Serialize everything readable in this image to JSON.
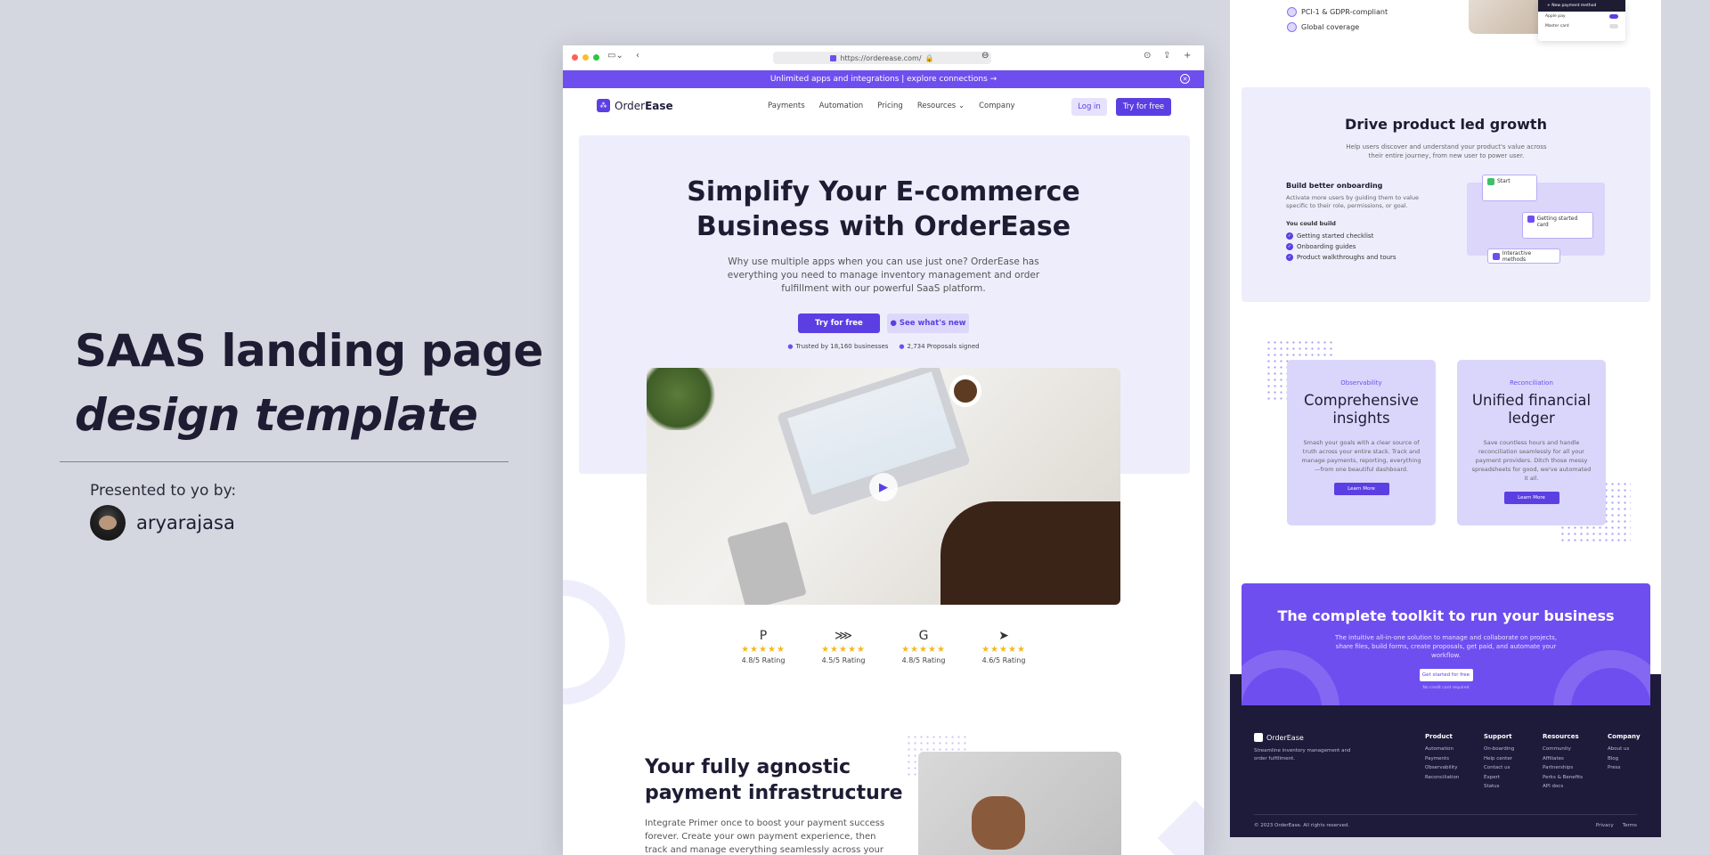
{
  "left": {
    "title_line1": "SAAS landing page",
    "title_line2": "design template",
    "presented": "Presented to yo by:",
    "author": "aryarajasa"
  },
  "browser": {
    "url": "https://orderease.com/",
    "banner": "Unlimited apps and integrations | explore connections →",
    "brand_prefix": "Order",
    "brand_suffix": "Ease",
    "nav": [
      "Payments",
      "Automation",
      "Pricing",
      "Resources ⌄",
      "Company"
    ],
    "login": "Log in",
    "try": "Try for free",
    "hero_title_1": "Simplify Your E-commerce",
    "hero_title_2": "Business with OrderEase",
    "hero_sub": "Why use multiple apps when you can use just one? OrderEase has everything you need to manage inventory management and order fulfillment with our powerful SaaS platform.",
    "cta_primary": "Try for free",
    "cta_secondary": "See what's new",
    "trust": [
      "Trusted by 18,160 businesses",
      "2,734 Proposals signed"
    ],
    "ratings": [
      {
        "icon": "P",
        "stars": "★★★★★",
        "label": "4.8/5 Rating"
      },
      {
        "icon": "⋙",
        "stars": "★★★★★",
        "label": "4.5/5 Rating"
      },
      {
        "icon": "G",
        "stars": "★★★★★",
        "label": "4.8/5 Rating"
      },
      {
        "icon": "➤",
        "stars": "★★★★★",
        "label": "4.6/5 Rating"
      }
    ],
    "section2_title_1": "Your fully agnostic",
    "section2_title_2": "payment infrastructure",
    "section2_text": "Integrate Primer once to boost your payment success forever. Create your own payment experience, then track and manage everything seamlessly across your"
  },
  "right": {
    "features": [
      "PCI-1 & GDPR-compliant",
      "Global coverage"
    ],
    "paycard": {
      "header": "+ New payment method",
      "rows": [
        "Apple pay",
        "Master card"
      ]
    },
    "drive_title": "Drive product led growth",
    "drive_sub": "Help users discover and understand your product's value across their entire journey, from new user to power user.",
    "onboarding_title": "Build better onboarding",
    "onboarding_text": "Activate more users by guiding them to value specific to their role, permissions, or goal.",
    "you_could": "You could build",
    "checklist": [
      "Getting started checklist",
      "Onboarding guides",
      "Product walkthroughs and tours"
    ],
    "flow": {
      "start": "Start",
      "card": "Getting started card",
      "methods": "Interactive methods"
    },
    "cards": [
      {
        "tag": "Observability",
        "title": "Comprehensive insights",
        "text": "Smash your goals with a clear source of truth across your entire stack. Track and manage payments, reporting, everything—from one beautiful dashboard.",
        "button": "Learn More"
      },
      {
        "tag": "Reconciliation",
        "title": "Unified financial ledger",
        "text": "Save countless hours and handle reconciliation seamlessly for all your payment providers. Ditch those messy spreadsheets for good, we've automated it all.",
        "button": "Learn More"
      }
    ],
    "toolkit_title": "The complete toolkit to run your business",
    "toolkit_text": "The intuitive all-in-one solution to manage and collaborate on projects, share files, build forms, create proposals, get paid, and automate your workflow.",
    "toolkit_button": "Get started for free",
    "toolkit_note": "No credit card required",
    "footer": {
      "brand": "OrderEase",
      "tagline": "Streamline inventory management and order fulfillment.",
      "columns": [
        {
          "title": "Product",
          "items": [
            "Automation",
            "Payments",
            "Observability",
            "Reconciliation"
          ]
        },
        {
          "title": "Support",
          "items": [
            "On-boarding",
            "Help center",
            "Contact us",
            "Expert",
            "Status"
          ]
        },
        {
          "title": "Resources",
          "items": [
            "Community",
            "Affiliates",
            "Partnerships",
            "Perks & Benefits",
            "API docs"
          ]
        },
        {
          "title": "Company",
          "items": [
            "About us",
            "Blog",
            "Press"
          ]
        }
      ],
      "copyright": "© 2023 OrderEase. All rights reserved.",
      "legal": [
        "Privacy",
        "Terms"
      ]
    }
  }
}
